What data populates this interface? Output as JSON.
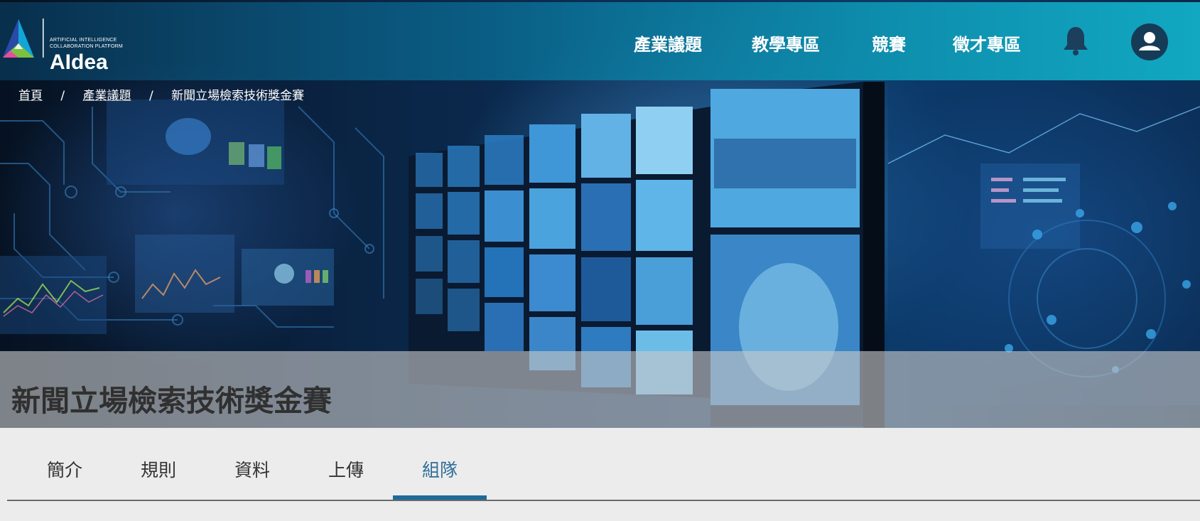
{
  "colors": {
    "header_accent": "#12afc8",
    "active_tab": "#2f6e99",
    "tab_underline": "#1e6a9a",
    "title_text": "#303030"
  },
  "logo": {
    "tagline_line1": "ARTIFICIAL INTELLIGENCE",
    "tagline_line2": "COLLABORATION PLATFORM",
    "name": "AIdea"
  },
  "nav": {
    "items": [
      {
        "label": "產業議題"
      },
      {
        "label": "教學專區"
      },
      {
        "label": "競賽"
      },
      {
        "label": "徵才專區"
      }
    ],
    "icons": [
      "bell-icon",
      "user-icon"
    ]
  },
  "breadcrumb": {
    "items": [
      "首頁",
      "產業議題",
      "新聞立場檢索技術獎金賽"
    ],
    "separator": "/"
  },
  "page": {
    "title": "新聞立場檢索技術獎金賽"
  },
  "tabs": {
    "items": [
      {
        "label": "簡介"
      },
      {
        "label": "規則"
      },
      {
        "label": "資料"
      },
      {
        "label": "上傳"
      },
      {
        "label": "組隊"
      }
    ],
    "active": "組隊"
  }
}
